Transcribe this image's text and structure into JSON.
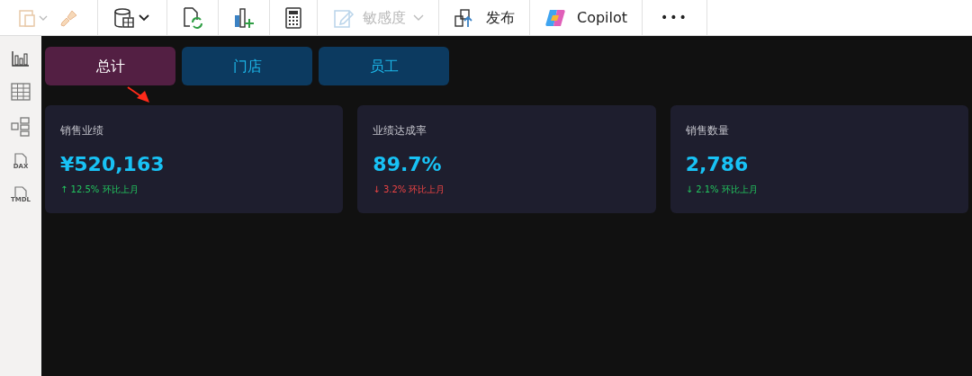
{
  "toolbar": {
    "sensitivity": {
      "label": "敏感度",
      "disabled": true
    },
    "publish": {
      "label": "发布"
    },
    "copilot": {
      "label": "Copilot"
    },
    "more": {
      "label": "•••"
    }
  },
  "sidebar": {
    "dax_label": "DAX",
    "tmdl_label": "TMDL"
  },
  "tabs": [
    {
      "label": "总计",
      "selected": true
    },
    {
      "label": "门店",
      "selected": false
    },
    {
      "label": "员工",
      "selected": false
    }
  ],
  "cards": [
    {
      "title": "销售业绩",
      "value": "¥520,163",
      "trend": "↑ 12.5% 环比上月",
      "color": "#22c55e"
    },
    {
      "title": "业绩达成率",
      "value": "89.7%",
      "trend": "↓ 3.2% 环比上月",
      "color": "#ef4444"
    },
    {
      "title": "销售数量",
      "value": "2,786",
      "trend": "↓ 2.1% 环比上月",
      "color": "#22c55e"
    }
  ]
}
